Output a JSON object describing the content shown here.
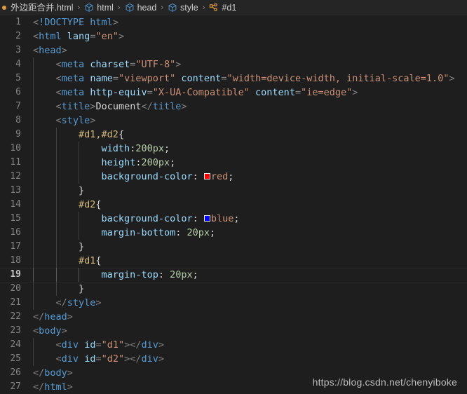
{
  "breadcrumb": {
    "dirty_indicator": true,
    "items": [
      {
        "label": "外边距合并.html",
        "icon": "html-file-icon"
      },
      {
        "label": "html",
        "icon": "symbol-cube-icon"
      },
      {
        "label": "head",
        "icon": "symbol-cube-icon"
      },
      {
        "label": "style",
        "icon": "symbol-cube-icon"
      },
      {
        "label": "#d1",
        "icon": "symbol-selector-icon"
      }
    ],
    "separator": "›"
  },
  "editor": {
    "active_line": 19,
    "total_lines": 27,
    "colors": {
      "background": "#1e1e1e",
      "breadcrumb_background": "#252526",
      "line_number": "#858585",
      "tag": "#569cd6",
      "attribute": "#9cdcfe",
      "string": "#ce9178",
      "selector": "#d7ba7d",
      "number": "#b5cea8",
      "punctuation": "#808080",
      "swatch_red": "#ff0000",
      "swatch_blue": "#0000ff"
    },
    "lines": [
      {
        "n": 1,
        "indent": 0,
        "guides": 0,
        "text": "<!DOCTYPE html>"
      },
      {
        "n": 2,
        "indent": 0,
        "guides": 0,
        "text": "<html lang=\"en\">"
      },
      {
        "n": 3,
        "indent": 0,
        "guides": 0,
        "text": "<head>"
      },
      {
        "n": 4,
        "indent": 1,
        "guides": 1,
        "text": "<meta charset=\"UTF-8\">"
      },
      {
        "n": 5,
        "indent": 1,
        "guides": 1,
        "text": "<meta name=\"viewport\" content=\"width=device-width, initial-scale=1.0\">"
      },
      {
        "n": 6,
        "indent": 1,
        "guides": 1,
        "text": "<meta http-equiv=\"X-UA-Compatible\" content=\"ie=edge\">"
      },
      {
        "n": 7,
        "indent": 1,
        "guides": 1,
        "text": "<title>Document</title>"
      },
      {
        "n": 8,
        "indent": 1,
        "guides": 1,
        "text": "<style>"
      },
      {
        "n": 9,
        "indent": 2,
        "guides": 2,
        "text": "#d1,#d2{"
      },
      {
        "n": 10,
        "indent": 3,
        "guides": 3,
        "text": "width:200px;"
      },
      {
        "n": 11,
        "indent": 3,
        "guides": 3,
        "text": "height:200px;"
      },
      {
        "n": 12,
        "indent": 3,
        "guides": 3,
        "text": "background-color: red;"
      },
      {
        "n": 13,
        "indent": 2,
        "guides": 2,
        "text": "}"
      },
      {
        "n": 14,
        "indent": 2,
        "guides": 2,
        "text": "#d2{"
      },
      {
        "n": 15,
        "indent": 3,
        "guides": 3,
        "text": "background-color: blue;"
      },
      {
        "n": 16,
        "indent": 3,
        "guides": 3,
        "text": "margin-bottom: 20px;"
      },
      {
        "n": 17,
        "indent": 2,
        "guides": 2,
        "text": "}"
      },
      {
        "n": 18,
        "indent": 2,
        "guides": 2,
        "text": "#d1{"
      },
      {
        "n": 19,
        "indent": 3,
        "guides": 3,
        "text": "margin-top: 20px;"
      },
      {
        "n": 20,
        "indent": 2,
        "guides": 2,
        "text": "}"
      },
      {
        "n": 21,
        "indent": 1,
        "guides": 1,
        "text": "</style>"
      },
      {
        "n": 22,
        "indent": 0,
        "guides": 0,
        "text": "</head>"
      },
      {
        "n": 23,
        "indent": 0,
        "guides": 0,
        "text": "<body>"
      },
      {
        "n": 24,
        "indent": 1,
        "guides": 1,
        "text": "<div id=\"d1\"></div>"
      },
      {
        "n": 25,
        "indent": 1,
        "guides": 1,
        "text": "<div id=\"d2\"></div>"
      },
      {
        "n": 26,
        "indent": 0,
        "guides": 0,
        "text": "</body>"
      },
      {
        "n": 27,
        "indent": 0,
        "guides": 0,
        "text": "</html>"
      }
    ]
  },
  "watermark": {
    "text": "https://blog.csdn.net/chenyiboke"
  }
}
